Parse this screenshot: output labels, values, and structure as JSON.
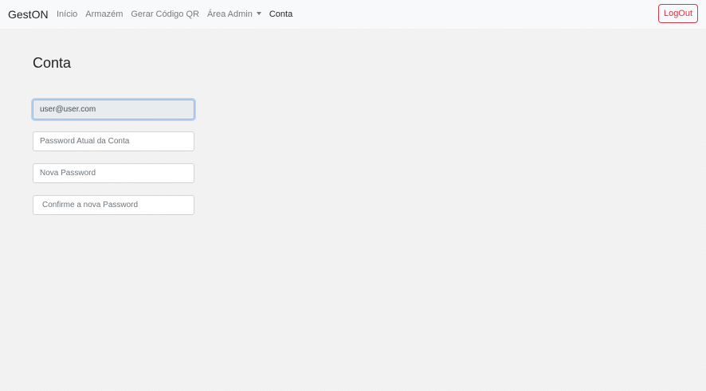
{
  "navbar": {
    "brand": "GestON",
    "links": [
      {
        "label": "Início"
      },
      {
        "label": "Armazém"
      },
      {
        "label": "Gerar Código QR"
      },
      {
        "label": "Área Admin"
      },
      {
        "label": "Conta"
      }
    ],
    "logout_label": "LogOut"
  },
  "main": {
    "title": "Conta",
    "email_value": "user@user.com",
    "current_password_placeholder": "Password Atual da Conta",
    "new_password_placeholder": "Nova Password",
    "confirm_password_placeholder": "Confirme a nova Password"
  },
  "colors": {
    "navbar_bg": "#f8f9fa",
    "danger": "#dc3545",
    "focus": "#80bdff"
  }
}
